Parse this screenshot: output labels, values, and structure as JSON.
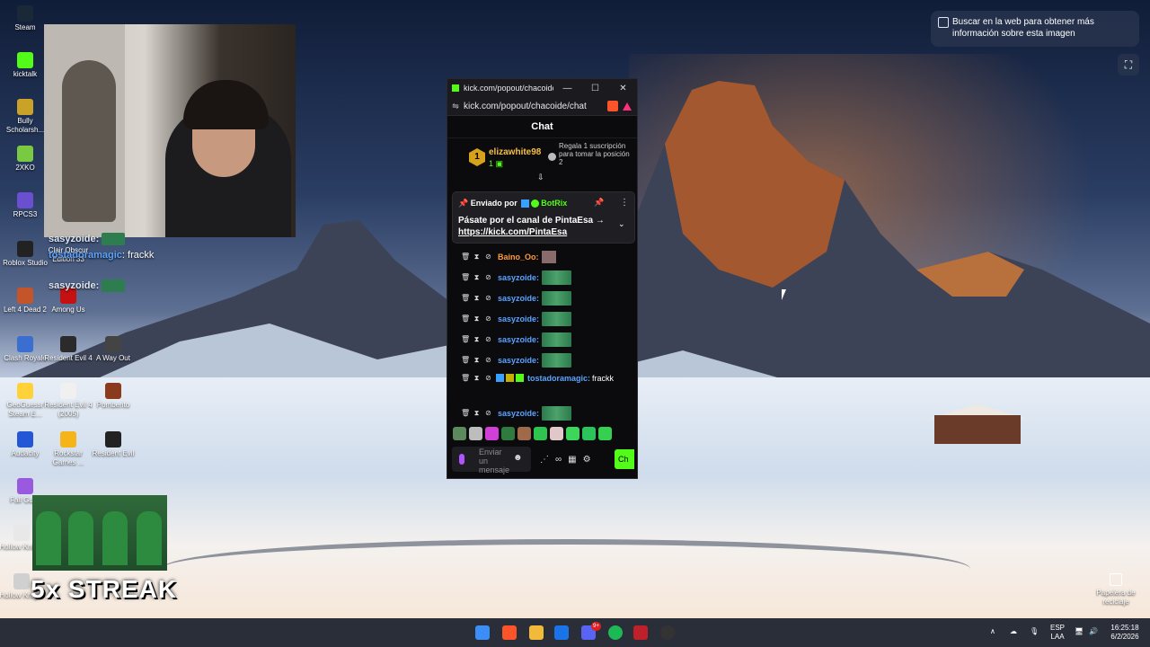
{
  "desktop": {
    "icons_col1": [
      "Steam",
      "kicktalk",
      "Bully Scholarsh...",
      "2XKO",
      "RPCS3",
      "Roblox Studio",
      "Left 4 Dead 2",
      "Clash Royale",
      "GeoGuessr Steam E...",
      "Audacity",
      "Fall Guys",
      "Hollow Knight",
      "Hollow Knight"
    ],
    "icons_col2": [
      "Clair Obscur Edition 33",
      "Among Us",
      "Resident Evil 4",
      "Resident Evil 4 (2005)",
      "Rockstar Games ..."
    ],
    "icons_col3": [
      "A Way Out",
      "Pomberito",
      "Resident Evil"
    ],
    "recycle_bin": "Papelera de reciclaje"
  },
  "lens": {
    "text": "Buscar en la web para obtener más información sobre esta imagen"
  },
  "overlay": {
    "line1_user": "sasyzoide:",
    "line2_user": "tostadoramagic",
    "line2_msg": ": frackk",
    "line3_user": "sasyzoide:",
    "streak": "5x STREAK"
  },
  "window": {
    "title": "kick.com/popout/chacoide/...",
    "url": "kick.com/popout/chacoide/chat",
    "minimize": "—",
    "maximize": "☐",
    "close": "✕"
  },
  "chat": {
    "header": "Chat",
    "gift": {
      "rank": "1",
      "user": "elizawhite98",
      "count": "1",
      "cta": "Regala 1 suscripción para tomar la posición 2"
    },
    "pinned": {
      "sent_by": "Enviado por",
      "bot": "BotRix",
      "body": "Pásate por el canal de PintaEsa →",
      "link": "https://kick.com/PintaEsa"
    },
    "messages": [
      {
        "user": "Baino_Oo:",
        "color": "#ff9a3c",
        "text": ""
      },
      {
        "user": "sasyzoide:",
        "color": "#5aa3ff",
        "text": ""
      },
      {
        "user": "sasyzoide:",
        "color": "#5aa3ff",
        "text": ""
      },
      {
        "user": "sasyzoide:",
        "color": "#5aa3ff",
        "text": ""
      },
      {
        "user": "sasyzoide:",
        "color": "#5aa3ff",
        "text": ""
      },
      {
        "user": "sasyzoide:",
        "color": "#5aa3ff",
        "text": ""
      },
      {
        "user": "tostadoramagic:",
        "color": "#5aa3ff",
        "text": "frackk"
      },
      {
        "user": "sasyzoide:",
        "color": "#5aa3ff",
        "text": ""
      }
    ],
    "input_placeholder": "Enviar un mensaje",
    "send_label": "Ch"
  },
  "taskbar": {
    "lang_top": "ESP",
    "lang_bottom": "LAA",
    "time": "16:25:18",
    "date": "6/2/2026",
    "discord_badge": "9+"
  },
  "colors": {
    "kick_green": "#53fc18",
    "chat_bg": "#0b0b0d"
  }
}
